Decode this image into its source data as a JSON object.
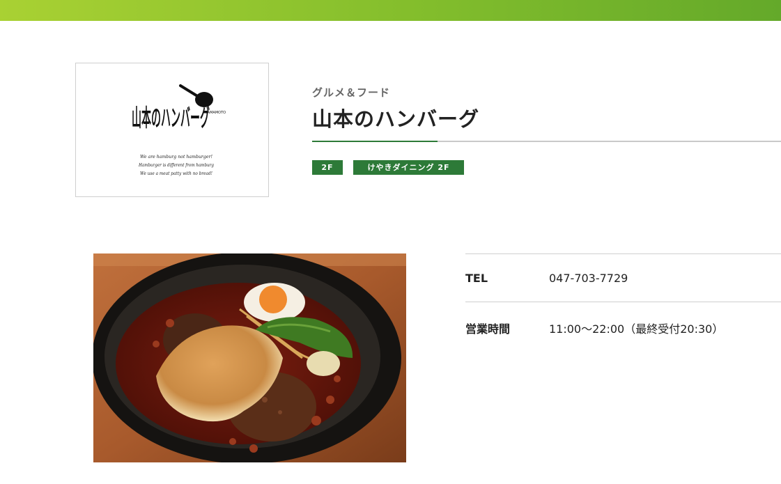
{
  "header": {
    "accent_color": "#82bd2c"
  },
  "shop": {
    "category": "グルメ＆フード",
    "name": "山本のハンバーグ",
    "tags": [
      {
        "label": "2F"
      },
      {
        "label": "けやきダイニング 2F"
      }
    ],
    "tag_color": "#2d7a38",
    "logo": {
      "brand_text_main": "山本のハンバーグ",
      "brand_text_sub": "YAMAMOTO",
      "tagline_lines": [
        "We are hamburg not hamburger!",
        "Hamburger is different from hamburg",
        "We use a meat patty with no bread!"
      ]
    },
    "photo_alt": "ハンバーグ"
  },
  "info": {
    "rows": [
      {
        "label": "TEL",
        "value": "047-703-7729"
      },
      {
        "label": "営業時間",
        "value": "11:00〜22:00（最終受付20:30）"
      }
    ]
  }
}
